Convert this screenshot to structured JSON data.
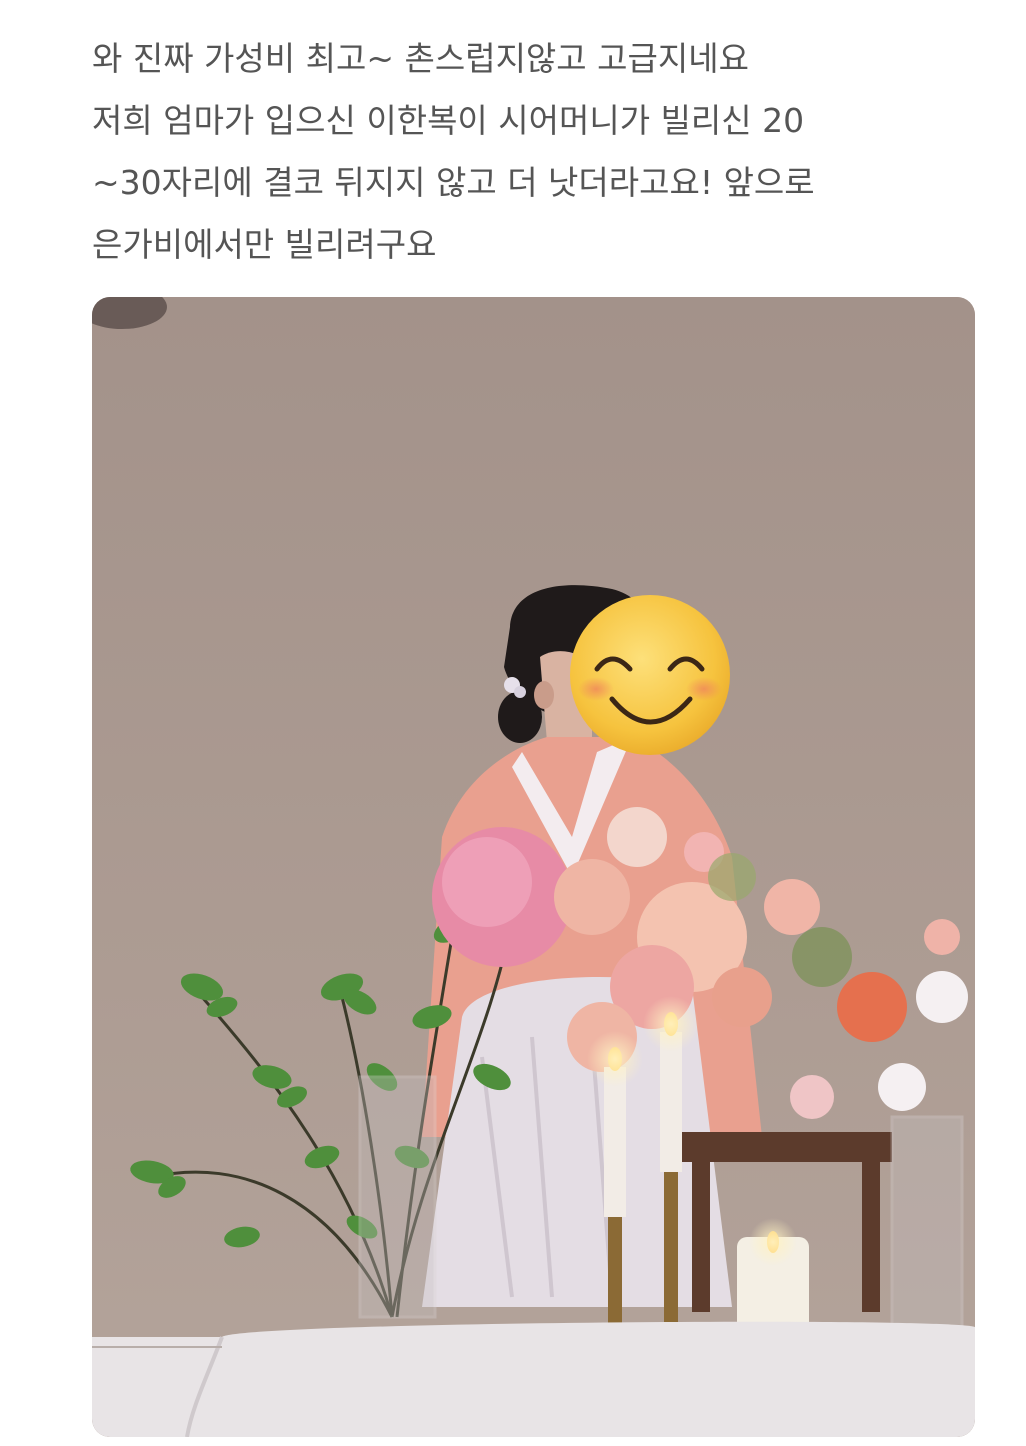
{
  "review": {
    "lines": [
      "와 진짜 가성비 최고~  촌스럽지않고 고급지네요",
      "저희 엄마가 입으신 이한복이 시어머니가 빌리신 20",
      "~30자리에 결코 뒤지지 않고 더 낫더라고요! 앞으로",
      "은가비에서만 빌리려구요"
    ]
  },
  "photo": {
    "subject": "woman-in-hanbok-with-flowers",
    "face_cover": "smiling-face-emoji",
    "colors": {
      "wall": "#a8978f",
      "hanbok_jacket": "#e9a08f",
      "hanbok_skirt": "#e4dde4",
      "hair": "#1f1a1a",
      "emoji": "#f6c33e",
      "tablecloth": "#e8e4e6",
      "greenery": "#4f8f3c",
      "peony_pink": "#e78ba6",
      "rose_peach": "#efb5a4",
      "orange_flower": "#e5704e"
    }
  }
}
